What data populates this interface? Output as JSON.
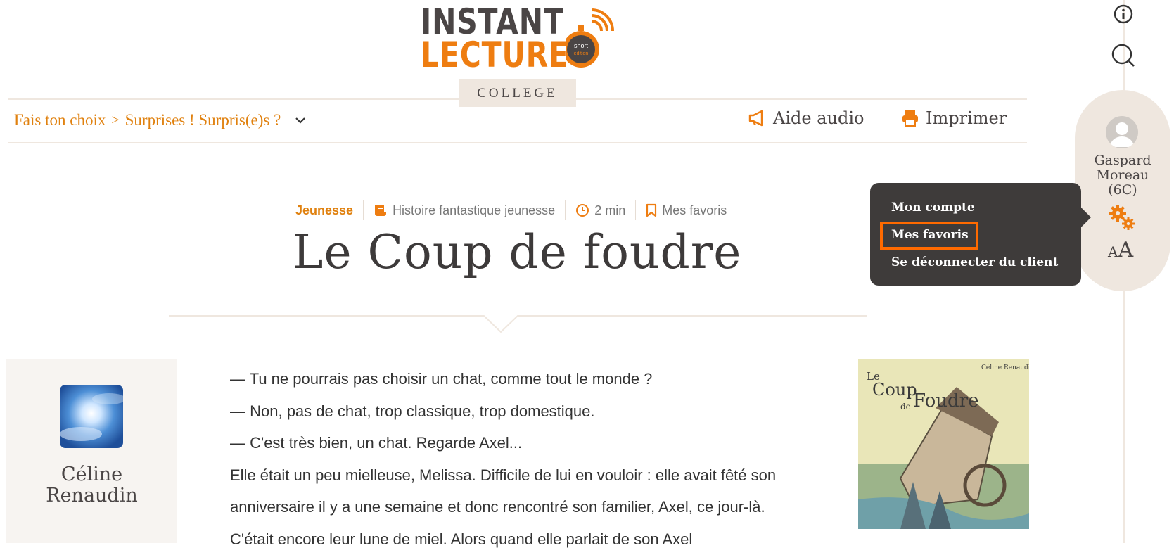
{
  "logo": {
    "line1": "INSTANT",
    "line2": "LECTURE",
    "badge": "short edition"
  },
  "tab": {
    "label": "COLLEGE"
  },
  "nav": {
    "breadcrumb": [
      {
        "label": "Fais ton choix"
      },
      {
        "label": "Surprises ! Surpris(e)s ?"
      }
    ],
    "separator": ">",
    "audio_label": "Aide audio",
    "print_label": "Imprimer"
  },
  "article": {
    "genre": "Jeunesse",
    "category": "Histoire fantastique jeunesse",
    "duration": "2 min",
    "favorites": "Mes favoris",
    "title": "Le Coup de foudre",
    "paragraphs": [
      "— Tu ne pourrais pas choisir un chat, comme tout le monde ?",
      "— Non, pas de chat, trop classique, trop domestique.",
      "— C'est très bien, un chat. Regarde Axel...",
      "Elle était un peu mielleuse, Melissa. Difficile de lui en vouloir : elle avait fêté son anniversaire il y a une semaine et donc rencontré son familier, Axel, ce jour-là. C'était encore leur lune de miel. Alors quand elle parlait de son Axel"
    ]
  },
  "author": {
    "name_line1": "Céline",
    "name_line2": "Renaudin"
  },
  "cover": {
    "author": "Céline Renaudin",
    "title_le": "Le",
    "title_coup": "Coup",
    "title_de": "de",
    "title_foudre": "Foudre"
  },
  "user": {
    "line1": "Gaspard",
    "line2": "Moreau",
    "line3": "(6C)"
  },
  "font_size_label": {
    "small": "A",
    "large": "A"
  },
  "menu": {
    "items": [
      {
        "label": "Mon compte"
      },
      {
        "label": "Mes favoris"
      },
      {
        "label": "Se déconnecter du client"
      }
    ],
    "highlighted_index": 1
  },
  "colors": {
    "accent": "#e0810f",
    "beige": "#efe7df",
    "menu_bg": "#3e3b3a",
    "highlight": "#ff6a00"
  },
  "icons": [
    "info-icon",
    "search-icon",
    "megaphone-icon",
    "printer-icon",
    "scroll-icon",
    "clock-icon",
    "bookmark-icon",
    "gear-icon",
    "chevron-down-icon"
  ]
}
